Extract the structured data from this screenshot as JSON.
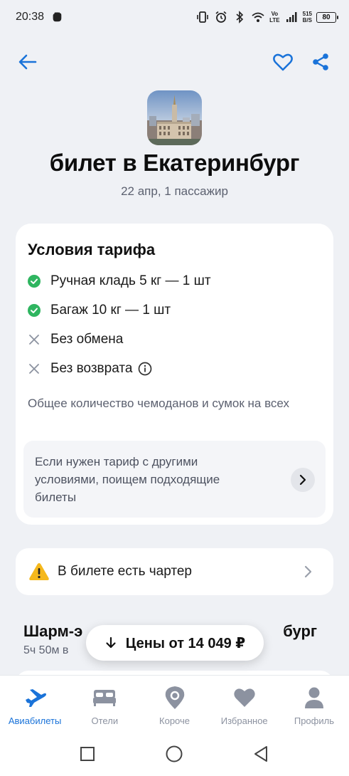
{
  "status_bar": {
    "time": "20:38",
    "volte_top": "Vo",
    "volte_bottom": "LTE",
    "net_speed_value": "515",
    "net_speed_unit": "B/S",
    "battery": "80"
  },
  "header": {
    "back_icon": "arrow-left-icon",
    "favorite_icon": "heart-outline-icon",
    "share_icon": "share-icon",
    "accent": "#1a73d9"
  },
  "trip": {
    "title": "билет в Екатеринбург",
    "subtitle": "22 апр, 1 пассажир"
  },
  "tariff": {
    "title": "Условия тарифа",
    "conditions": [
      {
        "label": "Ручная кладь 5 кг — 1 шт",
        "icon": "check-circle-icon",
        "included": true
      },
      {
        "label": "Багаж 10 кг — 1 шт",
        "icon": "check-circle-icon",
        "included": true
      },
      {
        "label": "Без обмена",
        "icon": "cross-icon",
        "included": false
      },
      {
        "label": "Без возврата",
        "icon": "cross-icon",
        "included": false
      }
    ],
    "note": "Общее количество чемоданов и сумок на всех",
    "other_tariff_text": "Если нужен тариф с другими условиями, поищем подходящие билеты"
  },
  "charter": {
    "text": "В билете есть чартер"
  },
  "flight": {
    "title_left": "Шарм-э",
    "title_right": "бург",
    "duration": "5ч 50м в"
  },
  "price_button": {
    "label": "Цены от 14 049 ₽"
  },
  "bottom_nav": {
    "items": [
      {
        "label": "Авиабилеты",
        "icon": "airplane-icon",
        "active": true
      },
      {
        "label": "Отели",
        "icon": "bed-icon",
        "active": false
      },
      {
        "label": "Короче",
        "icon": "location-pin-icon",
        "active": false
      },
      {
        "label": "Избранное",
        "icon": "heart-icon",
        "active": false
      },
      {
        "label": "Профиль",
        "icon": "person-icon",
        "active": false
      }
    ]
  },
  "colors": {
    "background": "#eff1f5",
    "check_green": "#2fb560",
    "cross_gray": "#8c92a0",
    "warning": "#f5b81c"
  }
}
